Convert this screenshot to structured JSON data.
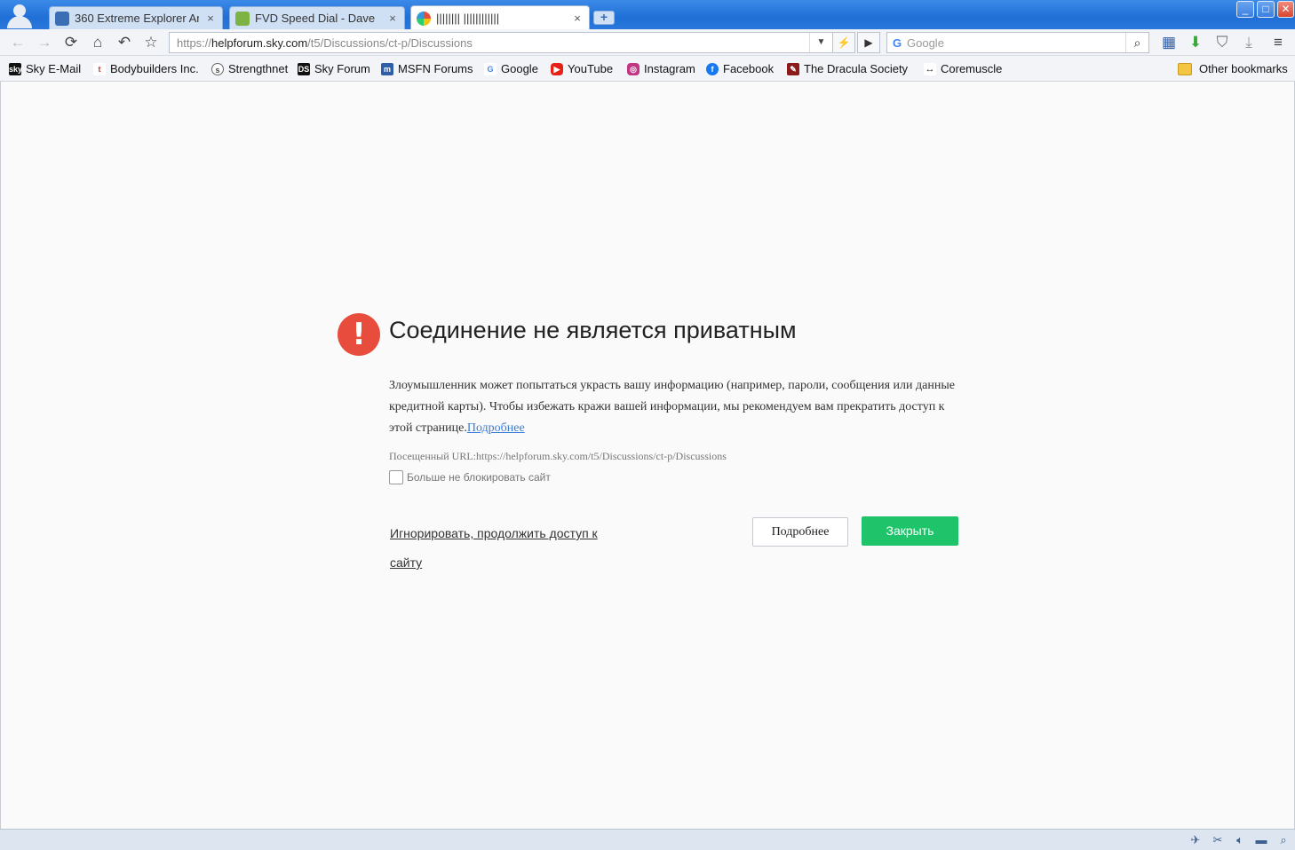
{
  "tabs": [
    {
      "title": "360 Extreme Explorer Ar",
      "close": "×",
      "active": false
    },
    {
      "title": "FVD Speed Dial - Dave",
      "close": "×",
      "active": false
    },
    {
      "title": "|||||||| ||||||||||||",
      "close": "×",
      "active": true
    }
  ],
  "new_tab": "+",
  "window": {
    "minimize": "_",
    "maximize": "□",
    "close": "✕"
  },
  "toolbar": {
    "url_scheme": "https://",
    "url_host": "helpforum.sky.com",
    "url_path": "/t5/Discussions/ct-p/Discussions",
    "search_placeholder": "Google"
  },
  "bookmarks": [
    {
      "label": "Sky E-Mail",
      "icon": "sky-icon",
      "color": "#111111"
    },
    {
      "label": "Bodybuilders Inc.",
      "icon": "t-icon",
      "color": "#ffffff"
    },
    {
      "label": "Strengthnet",
      "icon": "s-swirl-icon",
      "color": "#ffffff"
    },
    {
      "label": "Sky Forum",
      "icon": "ds-icon",
      "color": "#111111"
    },
    {
      "label": "MSFN Forums",
      "icon": "msfn-icon",
      "color": "#2f5fa8"
    },
    {
      "label": "Google",
      "icon": "google-icon",
      "color": "#ffffff"
    },
    {
      "label": "YouTube",
      "icon": "youtube-icon",
      "color": "#e62117"
    },
    {
      "label": "Instagram",
      "icon": "instagram-icon",
      "color": "#c13584"
    },
    {
      "label": "Facebook",
      "icon": "facebook-icon",
      "color": "#1877f2"
    },
    {
      "label": "The Dracula Society",
      "icon": "dracula-icon",
      "color": "#8b1a1a"
    },
    {
      "label": "Coremuscle",
      "icon": "arrows-icon",
      "color": "#ffffff"
    }
  ],
  "other_bookmarks": "Other bookmarks",
  "error": {
    "title": "Соединение не является приватным",
    "description": "Злоумышленник может попытаться украсть вашу информацию (например, пароли, сообщения или данные кредитной карты). Чтобы избежать кражи вашей информации, мы рекомендуем вам прекратить доступ к этой странице.",
    "more_link": "Подробнее",
    "visited_url": "Посещенный URL:https://helpforum.sky.com/t5/Discussions/ct-p/Discussions",
    "dont_block": "Больше не блокировать сайт",
    "ignore": "Игнорировать, продолжить доступ к сайту",
    "more_button": "Подробнее",
    "close_button": "Закрыть"
  },
  "colors": {
    "accent_green": "#1fc36a",
    "error_red": "#e74c3c",
    "link_blue": "#3b7dd8",
    "titlebar_blue": "#1f6fd6"
  }
}
